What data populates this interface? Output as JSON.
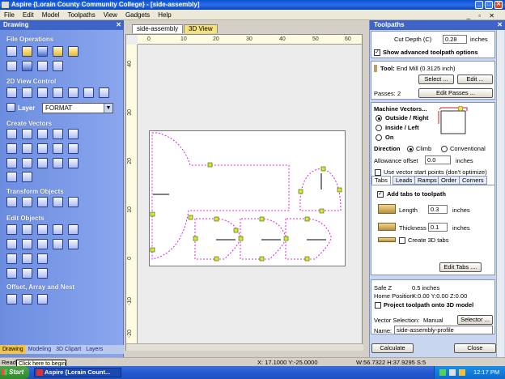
{
  "window": {
    "title": "Aspire {Lorain County Community College} - [side-assembly]",
    "controls": [
      "_",
      "□",
      "✕"
    ]
  },
  "menu": {
    "items": [
      "File",
      "Edit",
      "Model",
      "Toolpaths",
      "View",
      "Gadgets",
      "Help"
    ],
    "mdi_controls": "_ ▫ ✕"
  },
  "left_panel": {
    "title": "Drawing",
    "close": "✕",
    "sections": {
      "file_operations": "File Operations",
      "view_control": "2D View Control",
      "create_vectors": "Create Vectors",
      "transform_objects": "Transform Objects",
      "edit_objects": "Edit Objects",
      "offset_array": "Offset, Array and Nest"
    },
    "layer": {
      "label": "Layer",
      "value": "FORMAT"
    },
    "bottom_tabs": [
      "Drawing",
      "Modeling",
      "3D Clipart",
      "Layers"
    ]
  },
  "center": {
    "tabs": [
      "side-assembly",
      "3D View"
    ],
    "ruler_top": [
      "0",
      "10",
      "20",
      "30",
      "40",
      "50",
      "60"
    ],
    "ruler_left": [
      "40",
      "30",
      "20",
      "10",
      "0",
      "-10",
      "-20"
    ]
  },
  "toolpaths": {
    "title": "Toolpaths",
    "close": "✕",
    "cut_depth": {
      "label": "Cut Depth (C)",
      "value": "0.28",
      "unit": "inches"
    },
    "show_advanced": "Show advanced toolpath options",
    "tool": {
      "label": "Tool:",
      "name": "End Mill (0.3125 inch)",
      "select": "Select ...",
      "edit": "Edit ..."
    },
    "passes": {
      "label": "Passes:",
      "value": "2",
      "edit": "Edit Passes ..."
    },
    "machine_vectors": {
      "title": "Machine Vectors...",
      "options": [
        "Outside / Right",
        "Inside / Left",
        "On"
      ],
      "direction_label": "Direction",
      "direction_options": [
        "Climb",
        "Conventional"
      ],
      "allowance_label": "Allowance offset",
      "allowance_value": "0.0",
      "allowance_unit": "inches",
      "use_start_points": "Use vector start points (don't optimize)"
    },
    "tabs": [
      "Tabs",
      "Leads",
      "Ramps",
      "Order",
      "Corners"
    ],
    "tabs_panel": {
      "add_tabs": "Add tabs to toolpath",
      "length_label": "Length",
      "length_value": "0.3",
      "thickness_label": "Thickness",
      "thickness_value": "0.1",
      "unit": "inches",
      "create_3d": "Create 3D tabs",
      "edit_tabs": "Edit Tabs ...."
    },
    "safe_z": {
      "label": "Safe Z",
      "value": "0.5 inches"
    },
    "home": {
      "label": "Home Position",
      "value": "X:0.00 Y:0.00 Z:0.00"
    },
    "project_3d": "Project toolpath onto 3D model",
    "vector_selection": {
      "label": "Vector Selection:",
      "value": "Manual",
      "button": "Selector ..."
    },
    "name": {
      "label": "Name:",
      "value": "side-assembly-profile"
    },
    "calculate": "Calculate",
    "close_button": "Close"
  },
  "status": {
    "ready": "Ready",
    "xy": "X: 17.1000 Y:-25.0000",
    "wh": "W:56.7322  H:37.9295  S:5"
  },
  "tooltip": "Click here to begin",
  "taskbar": {
    "start": "Start",
    "item": "Aspire {Lorain Count...",
    "time": "12:17 PM"
  }
}
